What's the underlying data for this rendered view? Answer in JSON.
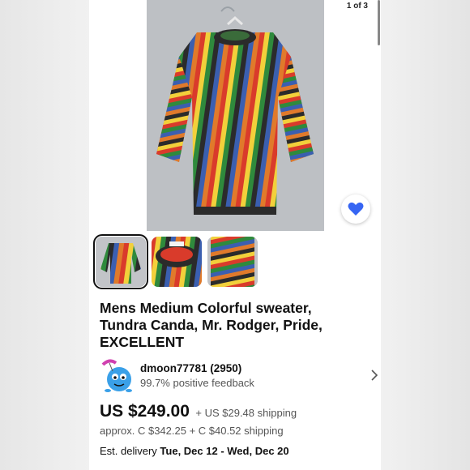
{
  "gallery": {
    "counter": "1 of 3",
    "thumbnails": [
      "thumb-front",
      "thumb-collar",
      "thumb-sleeve"
    ],
    "selected_index": 0,
    "favorite_icon": "heart-icon",
    "favorite_color": "#3665f3"
  },
  "listing": {
    "title": "Mens Medium Colorful sweater, Tundra Canda, Mr. Rodger, Pride, EXCELLENT"
  },
  "seller": {
    "name": "dmoon77781 (2950)",
    "feedback": "99.7% positive feedback",
    "avatar_icon": "cartoon-avatar-icon"
  },
  "pricing": {
    "price": "US $249.00",
    "shipping": "+ US $29.48 shipping",
    "approx": "approx. C $342.25 + C $40.52 shipping"
  },
  "delivery": {
    "label": "Est. delivery",
    "dates": "Tue, Dec 12 - Wed, Dec 20"
  },
  "colors": {
    "accent": "#3665f3",
    "text": "#111111",
    "muted": "#555555"
  }
}
